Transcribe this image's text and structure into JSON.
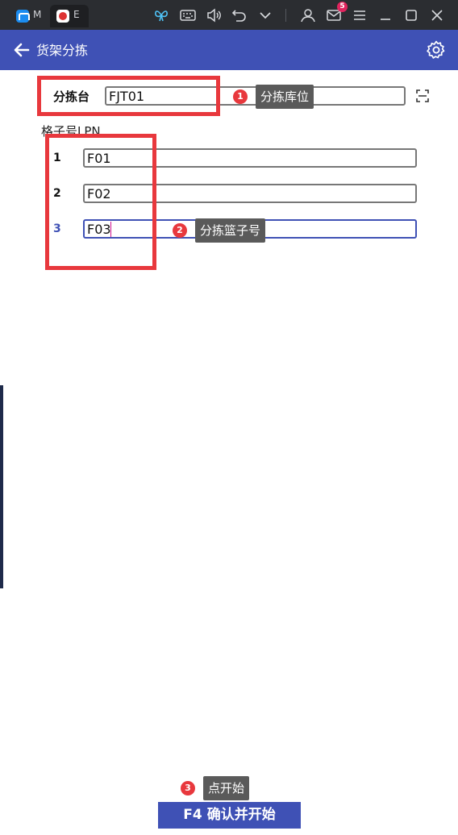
{
  "chrome": {
    "tabs": [
      {
        "label": "M",
        "icon": "app-m-icon"
      },
      {
        "label": "E",
        "icon": "app-e-icon"
      }
    ],
    "mail_badge": "5",
    "accent": "#3f51b5"
  },
  "appbar": {
    "title": "货架分拣"
  },
  "form": {
    "station_label": "分拣台",
    "station_value": "FJT01",
    "grid_title": "格子号LPN",
    "rows": [
      {
        "no": "1",
        "value": "F01"
      },
      {
        "no": "2",
        "value": "F02"
      },
      {
        "no": "3",
        "value": "F03"
      }
    ]
  },
  "annotations": [
    {
      "num": "1",
      "text": "分拣库位"
    },
    {
      "num": "2",
      "text": "分拣篮子号"
    },
    {
      "num": "3",
      "text": "点开始"
    }
  ],
  "confirm": {
    "key": "F4",
    "label": "确认并开始"
  }
}
